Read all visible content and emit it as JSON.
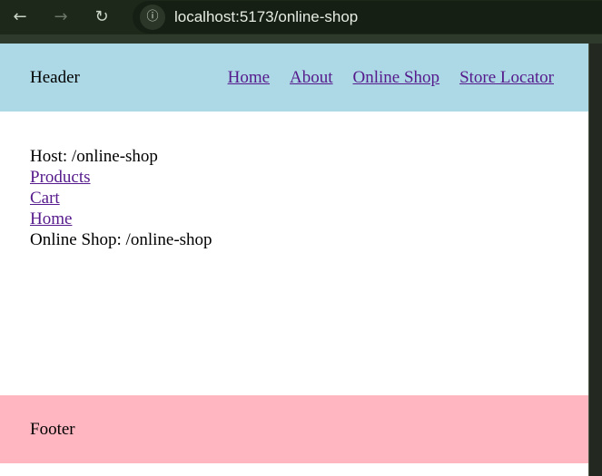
{
  "browser": {
    "url": "localhost:5173/online-shop"
  },
  "header": {
    "title": "Header",
    "links": [
      "Home",
      "About",
      "Online Shop",
      "Store Locator"
    ]
  },
  "content": {
    "host": "Host: /online-shop",
    "links": [
      "Products",
      "Cart",
      "Home"
    ],
    "shop": "Online Shop: /online-shop"
  },
  "footer": {
    "title": "Footer"
  }
}
